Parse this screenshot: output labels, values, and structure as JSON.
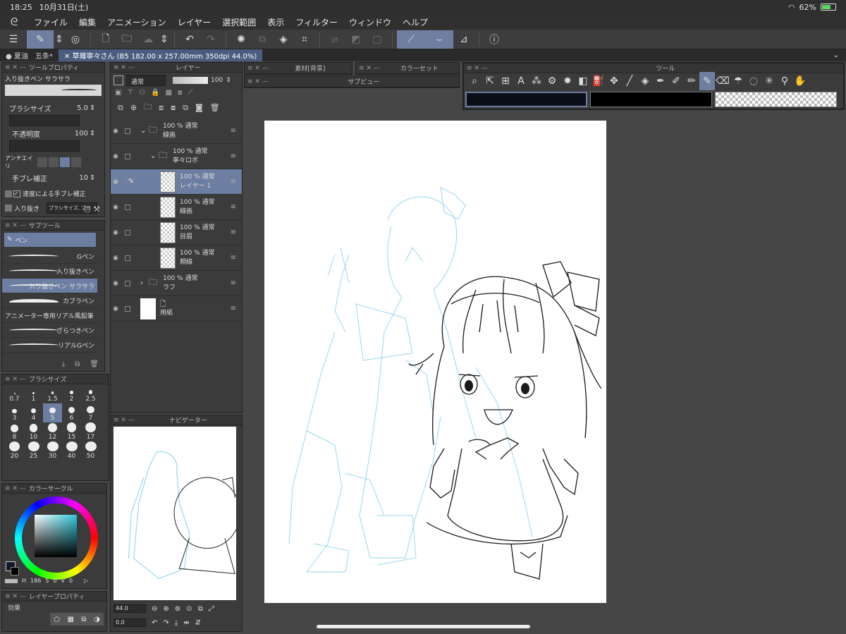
{
  "status": {
    "time": "18:25",
    "date": "10月31日(土)",
    "battery": "62%"
  },
  "menu": [
    "ファイル",
    "編集",
    "アニメーション",
    "レイヤー",
    "選択範囲",
    "表示",
    "フィルター",
    "ウィンドウ",
    "ヘルプ"
  ],
  "tabs": [
    {
      "label": "● 夏油　五条*"
    },
    {
      "label": "✕ 草薙寧々さん (B5 182.00 x 257.00mm 350dpi 44.0%)"
    }
  ],
  "tool_property": {
    "title": "ツールプロパティ",
    "preset": "入り抜きペン サラサラ",
    "brush_size_label": "ブラシサイズ",
    "brush_size": "5.0",
    "opacity_label": "不透明度",
    "opacity": "100",
    "antialias_label": "アンチエイリ",
    "stabilizer_label": "手ブレ補正",
    "stabilizer": "10",
    "speed_stabilizer_label": "速度による手ブレ補正",
    "taper_label": "入り抜き",
    "taper_value": "ブラシサイズ, ブラ"
  },
  "subtool": {
    "title": "サブツール",
    "group": "ペン",
    "items": [
      "Gペン",
      "入り抜きペン",
      "入り抜きペン サラサラ",
      "カブラペン",
      "アニメーター専用リアル風鉛筆",
      "ざらつきペン",
      "リアルGペン"
    ]
  },
  "brush_size_panel": {
    "title": "ブラシサイズ",
    "sizes": [
      "0.7",
      "1",
      "1.5",
      "2",
      "2.5",
      "3",
      "4",
      "5",
      "6",
      "7",
      "8",
      "10",
      "12",
      "15",
      "17",
      "20",
      "25",
      "30",
      "40",
      "50"
    ],
    "selected": "5"
  },
  "color_circle": {
    "title": "カラーサークル",
    "h": "186",
    "s": "0",
    "v": "0"
  },
  "layer_property": {
    "title": "レイヤープロパティ",
    "effect_label": "効果"
  },
  "layers_panel": {
    "title": "レイヤー",
    "blend_mode": "通常",
    "opacity": "100",
    "layers": [
      {
        "pct": "100 % 通常",
        "name": "線画",
        "type": "folder",
        "indent": 0
      },
      {
        "pct": "100 % 通常",
        "name": "寧々ロボ",
        "type": "folder",
        "indent": 1
      },
      {
        "pct": "100 % 通常",
        "name": "レイヤー 1",
        "type": "raster",
        "indent": 2,
        "selected": true
      },
      {
        "pct": "100 % 通常",
        "name": "線画",
        "type": "raster",
        "indent": 2
      },
      {
        "pct": "100 % 通常",
        "name": "目眉",
        "type": "raster",
        "indent": 2
      },
      {
        "pct": "100 % 通常",
        "name": "頬線",
        "type": "raster",
        "indent": 2
      },
      {
        "pct": "100 % 通常",
        "name": "ラフ",
        "type": "folder",
        "indent": 0
      },
      {
        "pct": "",
        "name": "用紙",
        "type": "paper",
        "indent": 0
      }
    ]
  },
  "material_tab": "素材[背景]",
  "colorset_tab": "カラーセット",
  "subview_tab": "サブビュー",
  "tool_panel_title": "ツール",
  "navigator": {
    "title": "ナビゲーター",
    "zoom": "44.0",
    "rotation": "0.0"
  },
  "colors": {
    "accent": "#6d7ea3",
    "tab_active": "#4a5d80",
    "lineart_blue": "#8fd3ec"
  }
}
